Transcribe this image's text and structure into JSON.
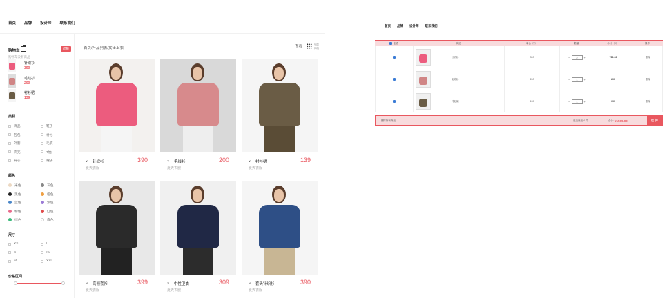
{
  "nav": [
    "首页",
    "品牌",
    "设计师",
    "联系我们"
  ],
  "cart": {
    "title": "购物车",
    "checkout_label": "结算",
    "note": "购物车没有商品",
    "items": [
      {
        "name": "针织衫",
        "price": "390",
        "color": "#ec5c7e"
      },
      {
        "name": "毛线衫",
        "price": "200",
        "color": "#d08585"
      },
      {
        "name": "衬衫裙",
        "price": "139",
        "color": "#6a5c45"
      }
    ]
  },
  "filters": {
    "category": {
      "title": "类别",
      "options": [
        "饰品",
        "鞋子",
        "包包",
        "衬衫",
        "外套",
        "毛衣",
        "夹克",
        "T恤",
        "背心",
        "裙子"
      ]
    },
    "color": {
      "title": "颜色",
      "options": [
        {
          "label": "米色",
          "hex": "#ecd8c2"
        },
        {
          "label": "灰色",
          "hex": "#888888"
        },
        {
          "label": "黑色",
          "hex": "#222222"
        },
        {
          "label": "橙色",
          "hex": "#f0a044"
        },
        {
          "label": "蓝色",
          "hex": "#4a86c8"
        },
        {
          "label": "紫色",
          "hex": "#9b7bd6"
        },
        {
          "label": "粉色",
          "hex": "#e96a8b"
        },
        {
          "label": "红色",
          "hex": "#e04c4c"
        },
        {
          "label": "绿色",
          "hex": "#3dbb7c"
        },
        {
          "label": "白色",
          "hex": "#ffffff"
        }
      ]
    },
    "size": {
      "title": "尺寸",
      "options": [
        "XS",
        "L",
        "S",
        "XL",
        "M",
        "XXL"
      ]
    },
    "price": {
      "title": "价格区间"
    }
  },
  "breadcrumb": "首页/产品列表/女士上衣",
  "view": {
    "label": "查看",
    "opt1": "列表",
    "opt2": "网格"
  },
  "products": [
    {
      "name": "针织衫",
      "price": "390",
      "season": "夏天衣服",
      "bg": "#f3f1ef",
      "top": "#ec5c7e",
      "bottom": "#f5f5f5"
    },
    {
      "name": "毛线衫",
      "price": "200",
      "season": "夏天衣服",
      "bg": "#d9d9d9",
      "top": "#d78a8c",
      "bottom": "#eee"
    },
    {
      "name": "衬衫裙",
      "price": "139",
      "season": "夏天衣服",
      "bg": "#f5f5f5",
      "top": "#6a5c45",
      "bottom": "#5a4c36"
    },
    {
      "name": "高领套衫",
      "price": "399",
      "season": "夏天衣服",
      "bg": "#e8e8e8",
      "top": "#2a2a2a",
      "bottom": "#222"
    },
    {
      "name": "中性卫衣",
      "price": "309",
      "season": "夏天衣服",
      "bg": "#f0f0f0",
      "top": "#202845",
      "bottom": "#2c2c2c"
    },
    {
      "name": "套头针织衫",
      "price": "390",
      "season": "夏天衣服",
      "bg": "#f5f5f5",
      "top": "#2e4f86",
      "bottom": "#c8b694"
    }
  ],
  "cart_table": {
    "nav": [
      "首页",
      "品牌",
      "设计师",
      "联系我们"
    ],
    "headers": [
      "全选",
      "商品",
      "单价（¥）",
      "数量",
      "小计（¥）",
      "操作"
    ],
    "rows": [
      {
        "name": "针织衫",
        "price": "390",
        "qty": "2",
        "subtotal": "780.00",
        "op": "删除",
        "color": "#ec5c7e"
      },
      {
        "name": "毛线衫",
        "price": "200",
        "qty": "1",
        "subtotal": "200",
        "op": "删除",
        "color": "#d08585"
      },
      {
        "name": "衬衫裙",
        "price": "139",
        "qty": "1",
        "subtotal": "399",
        "op": "删除",
        "color": "#6a5c45"
      }
    ],
    "delete_selected": "删除所有商品",
    "selected_count": "已选商品 4 件",
    "total_label": "合计：",
    "total": "¥1569.00",
    "checkout": "结 算"
  }
}
